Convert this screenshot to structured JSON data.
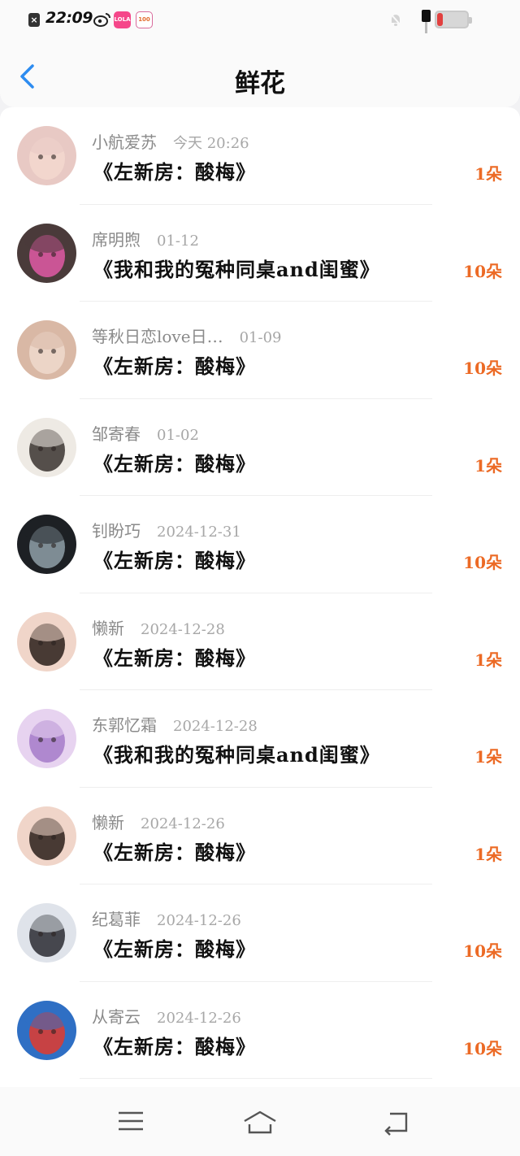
{
  "status_bar": {
    "time": "22:09",
    "battery_level": 0.18,
    "app_badge_1": "LOLA",
    "app_badge_2": "100"
  },
  "header": {
    "title": "鲜花"
  },
  "colors": {
    "accent_blue": "#2d8cf0",
    "count_orange": "#ec6a25",
    "battery_red": "#e2403f"
  },
  "list": [
    {
      "name": "小航爱苏",
      "date": "今天 20:26",
      "work": "《左新房：酸梅》",
      "count": "1朵"
    },
    {
      "name": "席明煦",
      "date": "01-12",
      "work": "《我和我的冤种同桌and闺蜜》",
      "count": "10朵"
    },
    {
      "name": "等秋日恋love日…",
      "date": "01-09",
      "work": "《左新房：酸梅》",
      "count": "10朵"
    },
    {
      "name": "邹寄春",
      "date": "01-02",
      "work": "《左新房：酸梅》",
      "count": "1朵"
    },
    {
      "name": "钊盼巧",
      "date": "2024-12-31",
      "work": "《左新房：酸梅》",
      "count": "10朵"
    },
    {
      "name": "懒新",
      "date": "2024-12-28",
      "work": "《左新房：酸梅》",
      "count": "1朵"
    },
    {
      "name": "东郭忆霜",
      "date": "2024-12-28",
      "work": "《我和我的冤种同桌and闺蜜》",
      "count": "1朵"
    },
    {
      "name": "懒新",
      "date": "2024-12-26",
      "work": "《左新房：酸梅》",
      "count": "1朵"
    },
    {
      "name": "纪葛菲",
      "date": "2024-12-26",
      "work": "《左新房：酸梅》",
      "count": "10朵"
    },
    {
      "name": "从寄云",
      "date": "2024-12-26",
      "work": "《左新房：酸梅》",
      "count": "10朵"
    }
  ],
  "avatars": [
    {
      "icon": "baby-photo-avatar-icon",
      "bg": "#e8c9c4",
      "fg": "#f3d8cf"
    },
    {
      "icon": "pink-car-avatar-icon",
      "bg": "#4a3b3a",
      "fg": "#e05aa6"
    },
    {
      "icon": "two-girls-avatar-icon",
      "bg": "#d9b8a5",
      "fg": "#efd9cc"
    },
    {
      "icon": "ink-painting-avatar-icon",
      "bg": "#eeeae4",
      "fg": "#3a3430"
    },
    {
      "icon": "water-drop-avatar-icon",
      "bg": "#1d2024",
      "fg": "#8fa0a8"
    },
    {
      "icon": "face-closeup-avatar-icon",
      "bg": "#f0d5c9",
      "fg": "#2a1e1a"
    },
    {
      "icon": "purple-anime-avatar-icon",
      "bg": "#e7d3f0",
      "fg": "#a57ac9"
    },
    {
      "icon": "face-closeup-avatar-icon",
      "bg": "#f0d5c9",
      "fg": "#2a1e1a"
    },
    {
      "icon": "girl-portrait-avatar-icon",
      "bg": "#dfe3ea",
      "fg": "#2b2b33"
    },
    {
      "icon": "cartoon-group-avatar-icon",
      "bg": "#2f6fc4",
      "fg": "#e23b2e"
    }
  ],
  "navbar": {
    "menu_icon": "menu-icon",
    "home_icon": "home-icon",
    "back_icon": "back-nav-icon"
  }
}
